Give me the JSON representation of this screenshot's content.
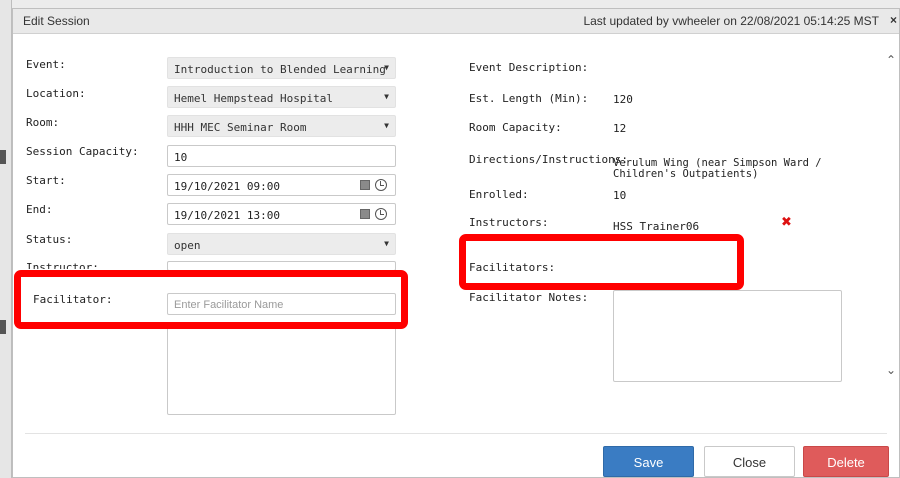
{
  "dialog": {
    "title": "Edit Session",
    "last_updated": "Last updated by vwheeler on 22/08/2021 05:14:25 MST",
    "close_glyph": "×"
  },
  "left": {
    "event_label": "Event:",
    "event_value": "Introduction to Blended Learning",
    "location_label": "Location:",
    "location_value": "Hemel Hempstead Hospital",
    "room_label": "Room:",
    "room_value": "HHH MEC Seminar Room",
    "capacity_label": "Session Capacity:",
    "capacity_value": "10",
    "start_label": "Start:",
    "start_value": "19/10/2021 09:00",
    "end_label": "End:",
    "end_value": "19/10/2021 13:00",
    "status_label": "Status:",
    "status_value": "open",
    "instructor_label": "Instructor:",
    "facilitator_label": "Facilitator:",
    "facilitator_placeholder": "Enter Facilitator Name"
  },
  "right": {
    "description_label": "Event Description:",
    "length_label": "Est. Length (Min):",
    "length_value": "120",
    "room_capacity_label": "Room Capacity:",
    "room_capacity_value": "12",
    "directions_label": "Directions/Instructions:",
    "directions_value_line1": "Verulum Wing (near Simpson Ward /",
    "directions_value_line2": "Children's Outpatients)",
    "enrolled_label": "Enrolled:",
    "enrolled_value": "10",
    "instructors_label": "Instructors:",
    "instructors_value": "HSS Trainer06",
    "remove_glyph": "✖",
    "facilitators_label": "Facilitators:",
    "facilitator_notes_label": "Facilitator Notes:"
  },
  "buttons": {
    "save": "Save",
    "close": "Close",
    "delete": "Delete"
  },
  "icons": {
    "dropdown": "chevron-down-icon",
    "calendar": "calendar-icon",
    "clock": "clock-icon",
    "scroll_up": "scroll-up-icon",
    "scroll_down": "scroll-down-icon"
  },
  "colors": {
    "save": "#3a7cc3",
    "delete": "#df5b5b",
    "highlight": "#ff0000",
    "remove": "#dd1111"
  }
}
